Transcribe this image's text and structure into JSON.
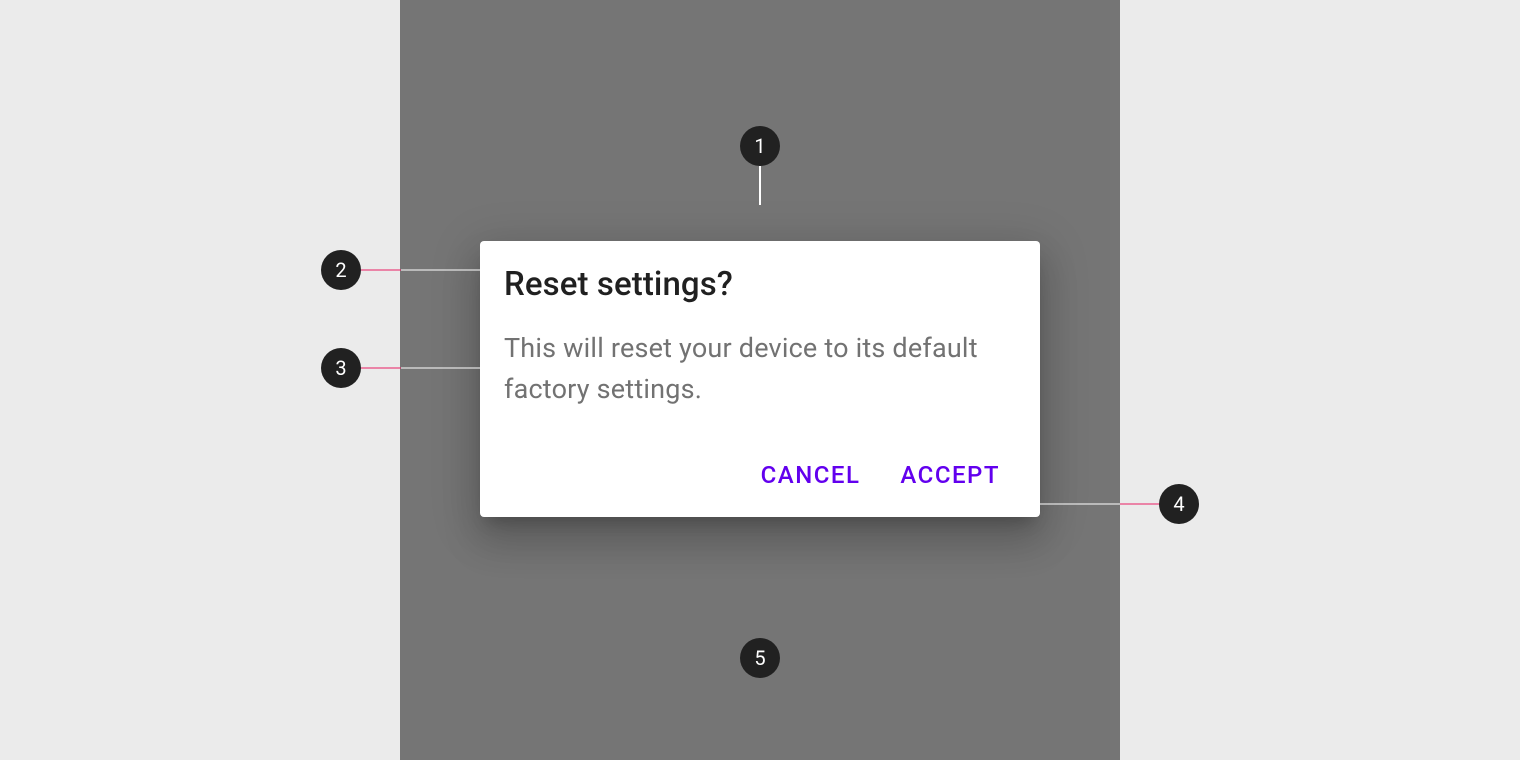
{
  "dialog": {
    "title": "Reset settings?",
    "body": "This will reset your device to its default factory settings.",
    "cancel_label": "Cancel",
    "accept_label": "Accept"
  },
  "annotations": {
    "n1": "1",
    "n2": "2",
    "n3": "3",
    "n4": "4",
    "n5": "5"
  },
  "colors": {
    "scrim": "#757575",
    "surface": "#ffffff",
    "primary": "#6200ee",
    "leader": "#e91e63",
    "callout_bg": "#212121"
  }
}
